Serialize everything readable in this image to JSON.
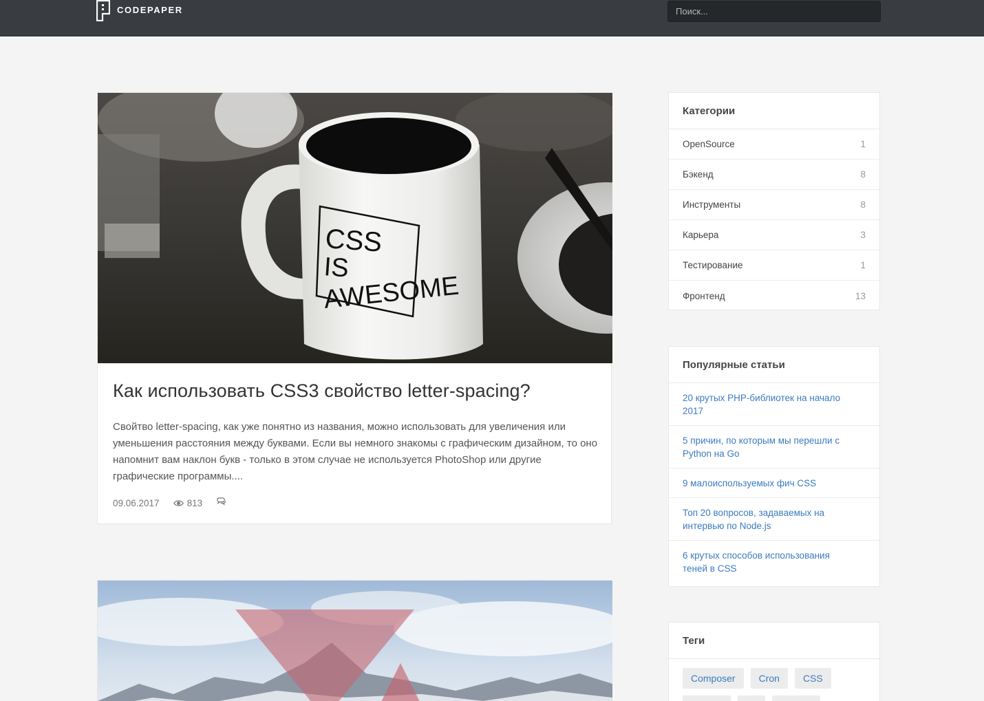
{
  "header": {
    "logo_text": "CODEPAPER",
    "search_placeholder": "Поиск..."
  },
  "articles": [
    {
      "image": "mug-photo",
      "mug_text": [
        "CSS",
        "IS",
        "AWESOME"
      ],
      "title": "Как использовать CSS3 свойство letter-spacing?",
      "excerpt": "Свойтво letter-spacing, как уже понятно из названия, можно использовать для увеличения или уменьшения расстояния между буквами. Если вы немного знакомы с графическим дизайном, то оно напомнит вам наклон букв - только в этом случае не используется PhotoShop или другие графические программы....",
      "date": "09.06.2017",
      "views": "813",
      "icons": {
        "views": "eye-icon",
        "comments": "comments-icon"
      }
    },
    {
      "image": "mountains-triangles-photo"
    }
  ],
  "sidebar": {
    "categories": {
      "title": "Категории",
      "items": [
        {
          "label": "OpenSource",
          "count": "1"
        },
        {
          "label": "Бэкенд",
          "count": "8"
        },
        {
          "label": "Инструменты",
          "count": "8"
        },
        {
          "label": "Карьера",
          "count": "3"
        },
        {
          "label": "Тестирование",
          "count": "1"
        },
        {
          "label": "Фронтенд",
          "count": "13"
        }
      ]
    },
    "popular": {
      "title": "Популярные статьи",
      "items": [
        "20 крутых PHP-библиотек на начало 2017",
        "5 причин, по которым мы перешли с Python на Go",
        "9 малоиспользуемых фич CSS",
        "Топ 20 вопросов, задаваемых на интервью по Node.js",
        "6 крутых способов использования теней в CSS"
      ]
    },
    "tags": {
      "title": "Теги",
      "items": [
        "Composer",
        "Cron",
        "CSS"
      ]
    }
  },
  "colors": {
    "header_bg": "#393d41",
    "page_bg": "#f4f4f4",
    "link": "#3b7bbf",
    "tag_bg": "#ececec"
  }
}
